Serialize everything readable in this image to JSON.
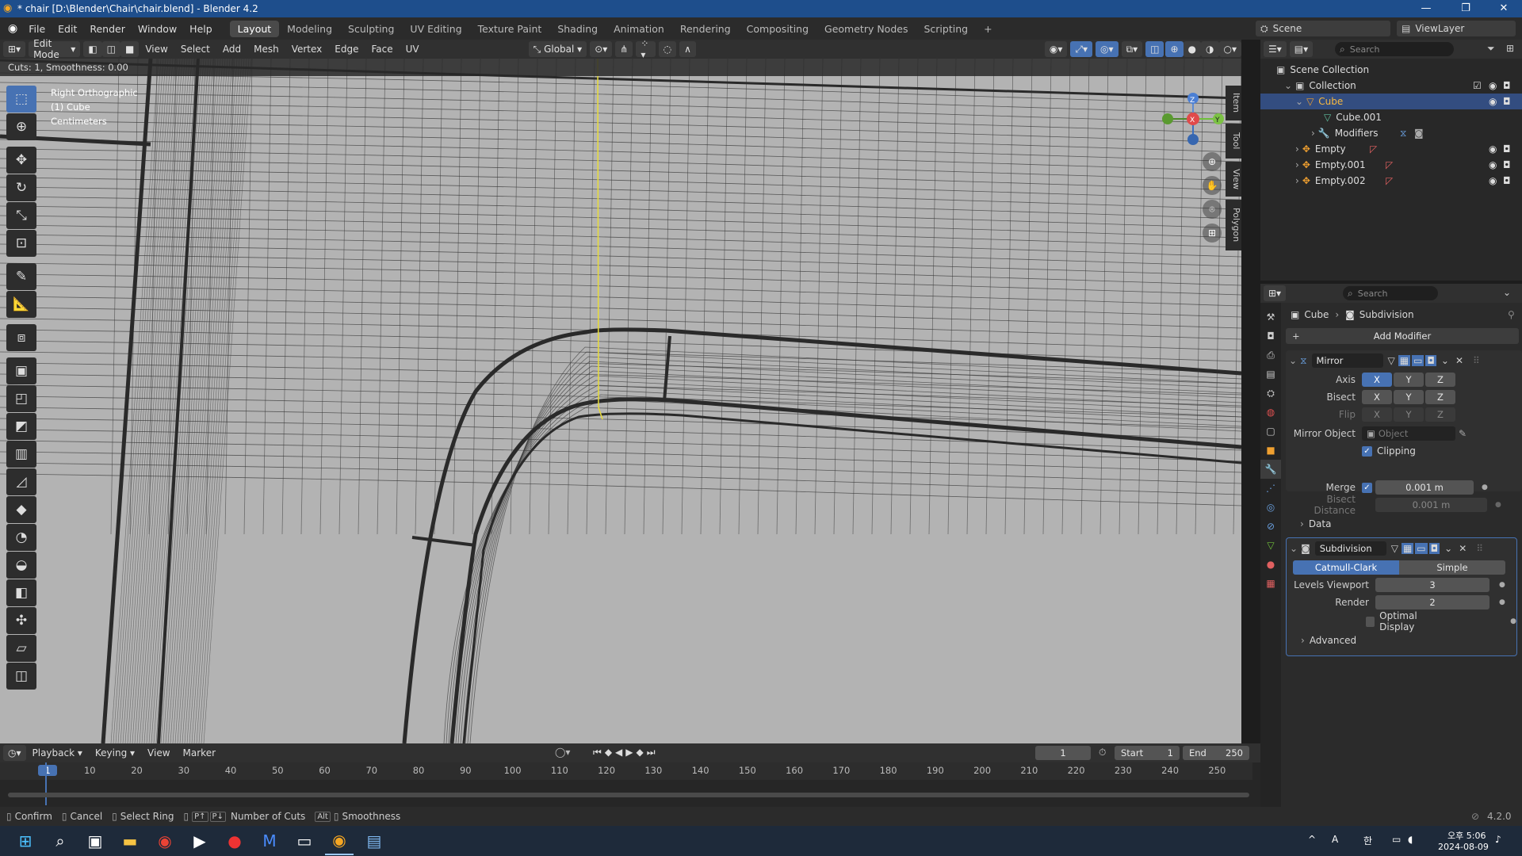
{
  "titlebar": {
    "title": "* chair [D:\\Blender\\Chair\\chair.blend] - Blender 4.2"
  },
  "menu": {
    "items": [
      "File",
      "Edit",
      "Render",
      "Window",
      "Help"
    ]
  },
  "workspaces": [
    "Layout",
    "Modeling",
    "Sculpting",
    "UV Editing",
    "Texture Paint",
    "Shading",
    "Animation",
    "Rendering",
    "Compositing",
    "Geometry Nodes",
    "Scripting"
  ],
  "scene": {
    "label": "Scene",
    "viewlayer": "ViewLayer"
  },
  "vheader": {
    "mode": "Edit Mode",
    "menus": [
      "View",
      "Select",
      "Add",
      "Mesh",
      "Vertex",
      "Edge",
      "Face",
      "UV"
    ],
    "orientation": "Global"
  },
  "operator_info": "Cuts: 1, Smoothness: 0.00",
  "viewport_overlay": {
    "line1": "Right Orthographic",
    "line2": "(1) Cube",
    "line3": "Centimeters"
  },
  "side_tabs": [
    "Item",
    "Tool",
    "View",
    "Polygon"
  ],
  "outliner": {
    "search_placeholder": "Search",
    "root": "Scene Collection",
    "collection": "Collection",
    "items": [
      {
        "name": "Cube",
        "selected": true
      },
      {
        "name": "Cube.001"
      },
      {
        "name": "Modifiers"
      },
      {
        "name": "Empty"
      },
      {
        "name": "Empty.001"
      },
      {
        "name": "Empty.002"
      }
    ]
  },
  "properties": {
    "search_placeholder": "Search",
    "breadcrumb_object": "Cube",
    "breadcrumb_modifier": "Subdivision",
    "add_modifier": "Add Modifier",
    "mirror": {
      "name": "Mirror",
      "axis_label": "Axis",
      "bisect_label": "Bisect",
      "flip_label": "Flip",
      "axes": [
        "X",
        "Y",
        "Z"
      ],
      "mirror_object_label": "Mirror Object",
      "mirror_object_placeholder": "Object",
      "clipping_label": "Clipping",
      "merge_label": "Merge",
      "merge_value": "0.001 m",
      "bisect_distance_label": "Bisect Distance",
      "bisect_distance_value": "0.001 m",
      "data_label": "Data"
    },
    "subdivision": {
      "name": "Subdivision",
      "catmull": "Catmull-Clark",
      "simple": "Simple",
      "levels_viewport_label": "Levels Viewport",
      "levels_viewport": "3",
      "render_label": "Render",
      "render": "2",
      "optimal_display": "Optimal Display",
      "advanced": "Advanced"
    }
  },
  "timeline": {
    "menus": [
      "Playback",
      "Keying",
      "View",
      "Marker"
    ],
    "current_frame": "1",
    "start_label": "Start",
    "start": "1",
    "end_label": "End",
    "end": "250",
    "ticks": [
      "1",
      "10",
      "20",
      "30",
      "40",
      "50",
      "60",
      "70",
      "80",
      "90",
      "100",
      "110",
      "120",
      "130",
      "140",
      "150",
      "160",
      "170",
      "180",
      "190",
      "200",
      "210",
      "220",
      "230",
      "240",
      "250"
    ]
  },
  "statusbar": {
    "confirm": "Confirm",
    "cancel": "Cancel",
    "select_ring": "Select Ring",
    "number_of_cuts": "Number of Cuts",
    "smoothness": "Smoothness",
    "version": "4.2.0"
  },
  "taskbar": {
    "ime": "A",
    "hangul": "한",
    "time": "오후 5:06",
    "date": "2024-08-09"
  }
}
